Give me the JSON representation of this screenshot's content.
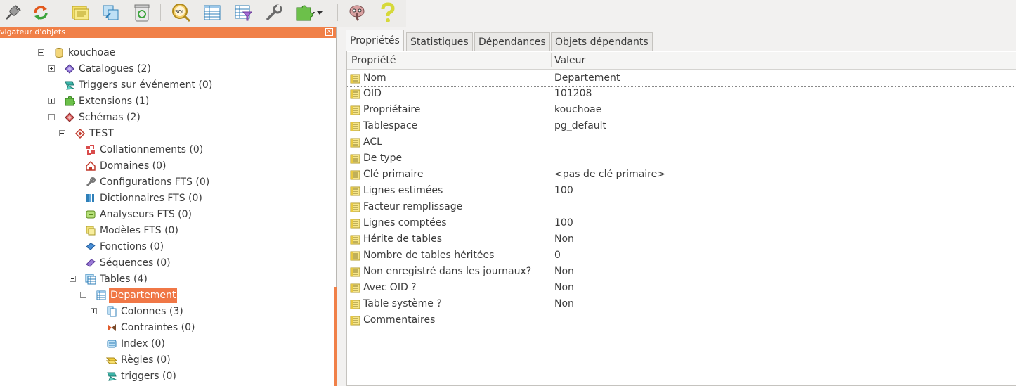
{
  "toolbar": {
    "buttons": [
      {
        "name": "connect-plug-icon"
      },
      {
        "name": "refresh-icon"
      },
      {
        "name": "open-folder-icon"
      },
      {
        "name": "copy-icon"
      },
      {
        "name": "recycle-bin-icon"
      },
      {
        "name": "sql-query-icon"
      },
      {
        "name": "view-data-icon"
      },
      {
        "name": "filtered-data-icon"
      },
      {
        "name": "maintenance-wrench-icon"
      },
      {
        "name": "plugin-puzzle-icon"
      },
      {
        "name": "elephant-hint-icon"
      },
      {
        "name": "help-icon"
      }
    ]
  },
  "browser": {
    "title": "vigateur d'objets",
    "close_label": "×",
    "partial_label": "......",
    "items": [
      {
        "label": "kouchoae"
      },
      {
        "label": "Catalogues (2)"
      },
      {
        "label": "Triggers sur événement (0)"
      },
      {
        "label": "Extensions (1)"
      },
      {
        "label": "Schémas (2)"
      },
      {
        "label": "TEST"
      },
      {
        "label": "Collationnements (0)"
      },
      {
        "label": "Domaines (0)"
      },
      {
        "label": "Configurations FTS (0)"
      },
      {
        "label": "Dictionnaires FTS (0)"
      },
      {
        "label": "Analyseurs FTS (0)"
      },
      {
        "label": "Modèles FTS (0)"
      },
      {
        "label": "Fonctions (0)"
      },
      {
        "label": "Séquences (0)"
      },
      {
        "label": "Tables (4)"
      },
      {
        "label": "Departement"
      },
      {
        "label": "Colonnes (3)"
      },
      {
        "label": "Contraintes (0)"
      },
      {
        "label": "Index (0)"
      },
      {
        "label": "Règles (0)"
      },
      {
        "label": "triggers (0)"
      }
    ]
  },
  "tabs": [
    {
      "label": "Propriétés"
    },
    {
      "label": "Statistiques"
    },
    {
      "label": "Dépendances"
    },
    {
      "label": "Objets dépendants"
    }
  ],
  "properties": {
    "col_name": "Propriété",
    "col_value": "Valeur",
    "rows": [
      {
        "name": "Nom",
        "value": "Departement"
      },
      {
        "name": "OID",
        "value": "101208"
      },
      {
        "name": "Propriétaire",
        "value": "kouchoae"
      },
      {
        "name": "Tablespace",
        "value": "pg_default"
      },
      {
        "name": "ACL",
        "value": ""
      },
      {
        "name": "De type",
        "value": ""
      },
      {
        "name": "Clé primaire",
        "value": "<pas de clé primaire>"
      },
      {
        "name": "Lignes estimées",
        "value": "100"
      },
      {
        "name": "Facteur remplissage",
        "value": ""
      },
      {
        "name": "Lignes comptées",
        "value": "100"
      },
      {
        "name": "Hérite de tables",
        "value": "Non"
      },
      {
        "name": "Nombre de tables héritées",
        "value": "0"
      },
      {
        "name": "Non enregistré dans les journaux?",
        "value": "Non"
      },
      {
        "name": "Avec OID ?",
        "value": "Non"
      },
      {
        "name": "Table système ?",
        "value": "Non"
      },
      {
        "name": "Commentaires",
        "value": ""
      }
    ]
  },
  "colors": {
    "accent_orange": "#f08048",
    "selection": "#f07746"
  }
}
